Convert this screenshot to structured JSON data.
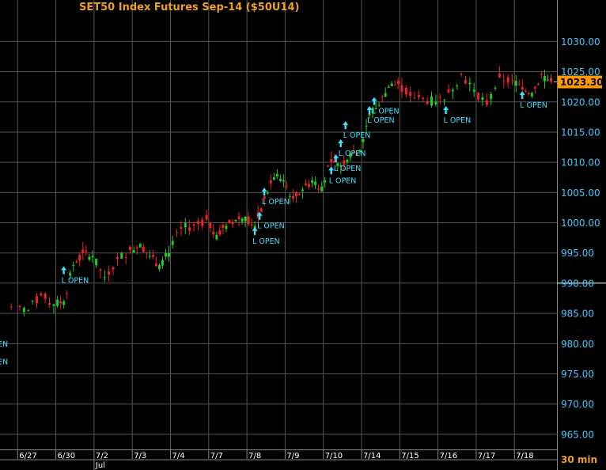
{
  "chart_data": {
    "type": "candlestick",
    "title": "SET50  Index Futures Sep-14  ($50U14)",
    "interval_label": "30  min",
    "ylim": [
      962.5,
      1034.5
    ],
    "yticks": [
      1030,
      1025,
      1020,
      1015,
      1010,
      1005,
      1000,
      995,
      990,
      985,
      980,
      975,
      970,
      965
    ],
    "ytick_labels": [
      "1030.00",
      "1025.00",
      "1020.00",
      "1015.00",
      "1010.00",
      "1005.00",
      "1000.00",
      "995.00",
      "990.00",
      "985.00",
      "980.00",
      "975.00",
      "970.00",
      "965.00"
    ],
    "reference_line": {
      "value": 990.0,
      "label": "990.00"
    },
    "last_price": {
      "value": 1023.3,
      "label": "1023.30"
    },
    "x_days": [
      "6/27",
      "6/30",
      "7/2",
      "7/3",
      "7/4",
      "7/7",
      "7/8",
      "7/9",
      "7/10",
      "7/14",
      "7/15",
      "7/16",
      "7/17",
      "7/18"
    ],
    "month_label": {
      "text": "Jul",
      "at_day": "7/2"
    },
    "session_close_path": [
      [
        "6/26",
        986.0
      ],
      [
        "6/27",
        985.5
      ],
      [
        "6/27",
        988.0
      ],
      [
        "6/27",
        986.5
      ],
      [
        "6/30",
        987.0
      ],
      [
        "6/30",
        993.0
      ],
      [
        "6/30",
        995.0
      ],
      [
        "6/30",
        994.5
      ],
      [
        "7/2",
        991.0
      ],
      [
        "7/2",
        994.0
      ],
      [
        "7/2",
        995.5
      ],
      [
        "7/3",
        996.5
      ],
      [
        "7/3",
        994.5
      ],
      [
        "7/3",
        993.0
      ],
      [
        "7/3",
        995.0
      ],
      [
        "7/4",
        999.0
      ],
      [
        "7/4",
        999.5
      ],
      [
        "7/4",
        1000.5
      ],
      [
        "7/7",
        998.0
      ],
      [
        "7/7",
        999.5
      ],
      [
        "7/7",
        1000.5
      ],
      [
        "7/7",
        1001.0
      ],
      [
        "7/8",
        999.5
      ],
      [
        "7/8",
        1004.0
      ],
      [
        "7/8",
        1007.5
      ],
      [
        "7/8",
        1007.0
      ],
      [
        "7/9",
        1004.0
      ],
      [
        "7/9",
        1005.5
      ],
      [
        "7/9",
        1007.0
      ],
      [
        "7/9",
        1006.0
      ],
      [
        "7/10",
        1010.0
      ],
      [
        "7/10",
        1009.5
      ],
      [
        "7/10",
        1011.5
      ],
      [
        "7/10",
        1012.0
      ],
      [
        "7/14",
        1018.0
      ],
      [
        "7/14",
        1019.5
      ],
      [
        "7/14",
        1022.5
      ],
      [
        "7/14",
        1023.0
      ],
      [
        "7/15",
        1021.0
      ],
      [
        "7/15",
        1020.5
      ],
      [
        "7/15",
        1020.0
      ],
      [
        "7/16",
        1021.5
      ],
      [
        "7/16",
        1024.5
      ],
      [
        "7/16",
        1022.0
      ],
      [
        "7/17",
        1019.5
      ],
      [
        "7/17",
        1024.0
      ],
      [
        "7/17",
        1023.5
      ],
      [
        "7/18",
        1022.0
      ],
      [
        "7/18",
        1021.5
      ],
      [
        "7/18",
        1024.5
      ],
      [
        "7/18",
        1023.3
      ]
    ],
    "up_color": "#22cc22",
    "down_color": "#ee2222",
    "signals": [
      {
        "label": "L  OPEN",
        "day": "6/30",
        "price": 991.5
      },
      {
        "label": "L  OPEN",
        "day": "7/8",
        "price": 998.0
      },
      {
        "label": "L  OPEN",
        "day": "7/8",
        "price": 1000.5
      },
      {
        "label": "L  OPEN",
        "day": "7/8",
        "price": 1004.5
      },
      {
        "label": "L  OPEN",
        "day": "7/10",
        "price": 1008.0
      },
      {
        "label": "L  OPEN",
        "day": "7/10",
        "price": 1010.0
      },
      {
        "label": "L  OPEN",
        "day": "7/10",
        "price": 1012.5
      },
      {
        "label": "L  OPEN",
        "day": "7/10",
        "price": 1015.5
      },
      {
        "label": "L  OPEN",
        "day": "7/14",
        "price": 1018.0
      },
      {
        "label": "L  OPEN",
        "day": "7/14",
        "price": 1019.5
      },
      {
        "label": "L  OPEN",
        "day": "7/16",
        "price": 1018.0
      },
      {
        "label": "L  OPEN",
        "day": "7/18",
        "price": 1020.5
      }
    ],
    "edge_signal_labels": [
      "EN",
      "EN"
    ],
    "grid": true
  },
  "colors": {
    "background": "#000000",
    "grid": "#555555",
    "title": "#f0a020",
    "axis_text": "#40c8ff",
    "signal": "#40e0ff",
    "last_price_box": "#ff9900",
    "reference_line": "#ffffff"
  }
}
